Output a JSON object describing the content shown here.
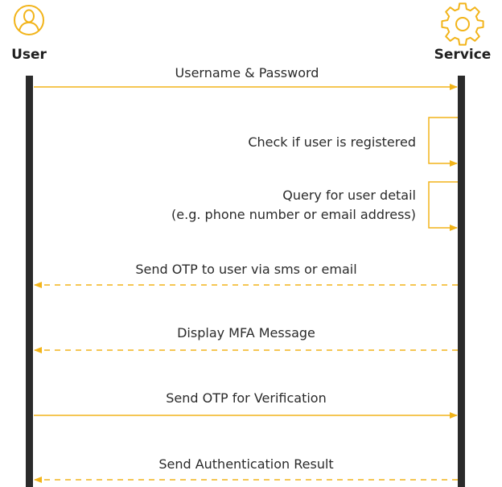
{
  "colors": {
    "accent": "#f2b41a",
    "lifeline": "#2b2b2b",
    "text": "#2a2a2a"
  },
  "actors": {
    "user": {
      "label": "User",
      "icon": "user-icon"
    },
    "service": {
      "label": "Service",
      "icon": "gear-icon"
    }
  },
  "messages": [
    {
      "id": "username-password",
      "lines": [
        "Username & Password"
      ],
      "from": "user",
      "to": "service",
      "style": "solid"
    },
    {
      "id": "check-registered",
      "lines": [
        "Check if user is registered"
      ],
      "from": "service",
      "to": "service",
      "style": "solid"
    },
    {
      "id": "query-user-detail",
      "lines": [
        "Query for user detail",
        "(e.g. phone number or email address)"
      ],
      "from": "service",
      "to": "service",
      "style": "solid"
    },
    {
      "id": "send-otp",
      "lines": [
        "Send OTP to user via sms or email"
      ],
      "from": "service",
      "to": "user",
      "style": "dashed"
    },
    {
      "id": "display-mfa",
      "lines": [
        "Display MFA Message"
      ],
      "from": "service",
      "to": "user",
      "style": "dashed"
    },
    {
      "id": "send-otp-verification",
      "lines": [
        "Send OTP for Verification"
      ],
      "from": "user",
      "to": "service",
      "style": "solid"
    },
    {
      "id": "auth-result",
      "lines": [
        "Send Authentication Result"
      ],
      "from": "service",
      "to": "user",
      "style": "dashed"
    }
  ]
}
